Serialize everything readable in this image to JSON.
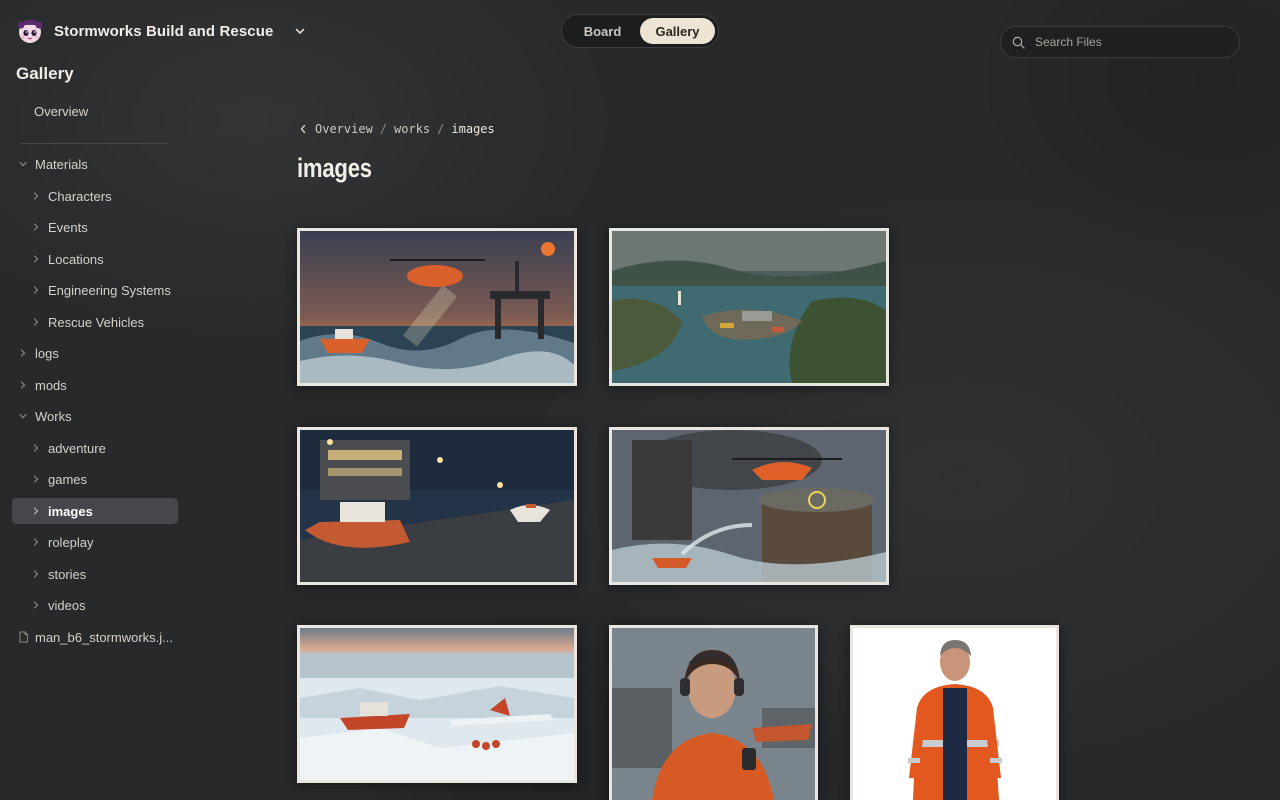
{
  "header": {
    "app_title": "Stormworks Build and Rescue",
    "logo_icon": "mascot-face-icon",
    "switch_icon": "chevron-down-icon"
  },
  "view_toggle": {
    "board_label": "Board",
    "gallery_label": "Gallery",
    "active": "Gallery"
  },
  "search": {
    "placeholder": "Search Files",
    "value": ""
  },
  "sidebar": {
    "heading": "Gallery",
    "overview_label": "Overview",
    "tree": [
      {
        "label": "Materials",
        "expanded": true
      },
      {
        "label": "Characters",
        "expanded": false
      },
      {
        "label": "Events",
        "expanded": false
      },
      {
        "label": "Locations",
        "expanded": false
      },
      {
        "label": "Engineering Systems",
        "expanded": false
      },
      {
        "label": "Rescue Vehicles",
        "expanded": false
      },
      {
        "label": "logs",
        "expanded": false
      },
      {
        "label": "mods",
        "expanded": false
      },
      {
        "label": "Works",
        "expanded": true
      },
      {
        "label": "adventure",
        "expanded": false
      },
      {
        "label": "games",
        "expanded": false
      },
      {
        "label": "images",
        "expanded": false,
        "selected": true
      },
      {
        "label": "roleplay",
        "expanded": false
      },
      {
        "label": "stories",
        "expanded": false
      },
      {
        "label": "videos",
        "expanded": false
      },
      {
        "label": "man_b6_stormworks.j...",
        "type": "file"
      }
    ]
  },
  "breadcrumb": {
    "items": [
      "Overview",
      "works",
      "images"
    ]
  },
  "page_title": "images",
  "colors": {
    "background": "#27292b",
    "toggle_active_bg": "#eee4d3",
    "selected_item_bg": "#45474c",
    "thumb_border": "#e9e6e0"
  }
}
